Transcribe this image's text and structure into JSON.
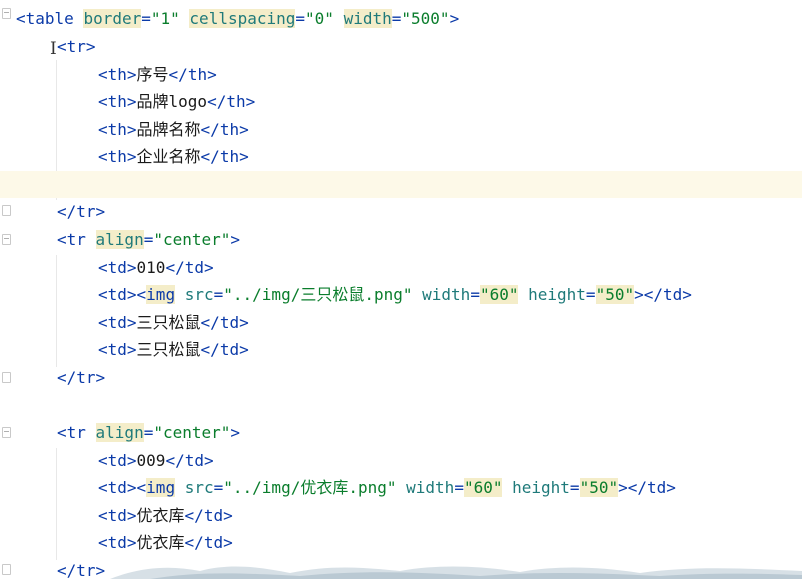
{
  "lines": [
    {
      "id": "l1",
      "segments": [
        [
          "tag",
          "<table "
        ],
        [
          "attr hl",
          "border"
        ],
        [
          "tag",
          "="
        ],
        [
          "str",
          "\"1\""
        ],
        [
          "tag",
          " "
        ],
        [
          "attr hl",
          "cellspacing"
        ],
        [
          "tag",
          "="
        ],
        [
          "str",
          "\"0\""
        ],
        [
          "tag",
          " "
        ],
        [
          "attr hl",
          "width"
        ],
        [
          "tag",
          "="
        ],
        [
          "str",
          "\"500\""
        ],
        [
          "tag",
          ">"
        ]
      ]
    },
    {
      "id": "l2",
      "segments": [
        [
          "tag",
          "<tr>"
        ]
      ]
    },
    {
      "id": "l3",
      "segments": [
        [
          "tag",
          "<th>"
        ],
        [
          "txt",
          "序号"
        ],
        [
          "tag",
          "</th>"
        ]
      ]
    },
    {
      "id": "l4",
      "segments": [
        [
          "tag",
          "<th>"
        ],
        [
          "txt",
          "品牌logo"
        ],
        [
          "tag",
          "</th>"
        ]
      ]
    },
    {
      "id": "l5",
      "segments": [
        [
          "tag",
          "<th>"
        ],
        [
          "txt",
          "品牌名称"
        ],
        [
          "tag",
          "</th>"
        ]
      ]
    },
    {
      "id": "l6",
      "segments": [
        [
          "tag",
          "<th>"
        ],
        [
          "txt",
          "企业名称"
        ],
        [
          "tag",
          "</th>"
        ]
      ]
    },
    {
      "id": "l7",
      "segments": []
    },
    {
      "id": "l8",
      "segments": [
        [
          "tag",
          "</tr>"
        ]
      ]
    },
    {
      "id": "l9",
      "segments": [
        [
          "tag",
          "<tr "
        ],
        [
          "attr hl",
          "align"
        ],
        [
          "tag",
          "="
        ],
        [
          "str",
          "\"center\""
        ],
        [
          "tag",
          ">"
        ]
      ]
    },
    {
      "id": "l10",
      "segments": [
        [
          "tag",
          "<td>"
        ],
        [
          "txt",
          "010"
        ],
        [
          "tag",
          "</td>"
        ]
      ]
    },
    {
      "id": "l11",
      "segments": [
        [
          "tag",
          "<td><"
        ],
        [
          "tag hlbg",
          "img"
        ],
        [
          "tag",
          " "
        ],
        [
          "attr",
          "src"
        ],
        [
          "tag",
          "="
        ],
        [
          "str",
          "\"../img/三只松鼠.png\""
        ],
        [
          "tag",
          " "
        ],
        [
          "attr",
          "width"
        ],
        [
          "tag",
          "="
        ],
        [
          "str hl",
          "\"60\""
        ],
        [
          "tag",
          " "
        ],
        [
          "attr",
          "height"
        ],
        [
          "tag",
          "="
        ],
        [
          "str hl",
          "\"50\""
        ],
        [
          "tag",
          "></td>"
        ]
      ]
    },
    {
      "id": "l12",
      "segments": [
        [
          "tag",
          "<td>"
        ],
        [
          "txt",
          "三只松鼠"
        ],
        [
          "tag",
          "</td>"
        ]
      ]
    },
    {
      "id": "l13",
      "segments": [
        [
          "tag",
          "<td>"
        ],
        [
          "txt",
          "三只松鼠"
        ],
        [
          "tag",
          "</td>"
        ]
      ]
    },
    {
      "id": "l14",
      "segments": [
        [
          "tag",
          "</tr>"
        ]
      ]
    },
    {
      "id": "l15",
      "segments": []
    },
    {
      "id": "l16",
      "segments": [
        [
          "tag",
          "<tr "
        ],
        [
          "attr hl",
          "align"
        ],
        [
          "tag",
          "="
        ],
        [
          "str",
          "\"center\""
        ],
        [
          "tag",
          ">"
        ]
      ]
    },
    {
      "id": "l17",
      "segments": [
        [
          "tag",
          "<td>"
        ],
        [
          "txt",
          "009"
        ],
        [
          "tag",
          "</td>"
        ]
      ]
    },
    {
      "id": "l18",
      "segments": [
        [
          "tag",
          "<td><"
        ],
        [
          "tag hlbg",
          "img"
        ],
        [
          "tag",
          " "
        ],
        [
          "attr",
          "src"
        ],
        [
          "tag",
          "="
        ],
        [
          "str",
          "\"../img/优衣库.png\""
        ],
        [
          "tag",
          " "
        ],
        [
          "attr",
          "width"
        ],
        [
          "tag",
          "="
        ],
        [
          "str hl",
          "\"60\""
        ],
        [
          "tag",
          " "
        ],
        [
          "attr",
          "height"
        ],
        [
          "tag",
          "="
        ],
        [
          "str hl",
          "\"50\""
        ],
        [
          "tag",
          "></td>"
        ]
      ]
    },
    {
      "id": "l19",
      "segments": [
        [
          "tag",
          "<td>"
        ],
        [
          "txt",
          "优衣库"
        ],
        [
          "tag",
          "</td>"
        ]
      ]
    },
    {
      "id": "l20",
      "segments": [
        [
          "tag",
          "<td>"
        ],
        [
          "txt",
          "优衣库"
        ],
        [
          "tag",
          "</td>"
        ]
      ]
    },
    {
      "id": "l21",
      "segments": [
        [
          "tag",
          "</tr>"
        ]
      ]
    }
  ],
  "colors": {
    "tag": "#0b3aa8",
    "attribute": "#1f7a7a",
    "string": "#0a7d2c",
    "highlight": "#f4edc9",
    "current_line": "#fdf9e8"
  }
}
